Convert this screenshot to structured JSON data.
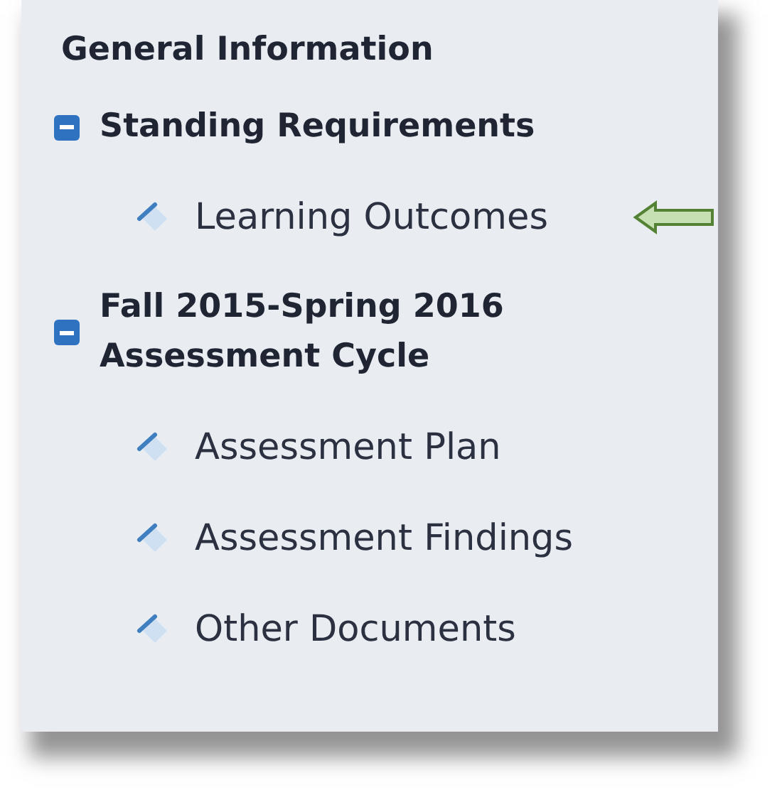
{
  "heading": "General Information",
  "groups": [
    {
      "title": "Standing Requirements",
      "expanded": true,
      "children": [
        {
          "label": "Learning Outcomes",
          "pointed": true
        }
      ]
    },
    {
      "title": "Fall 2015-Spring 2016 Assessment Cycle",
      "expanded": true,
      "children": [
        {
          "label": "Assessment Plan",
          "pointed": false
        },
        {
          "label": "Assessment Findings",
          "pointed": false
        },
        {
          "label": "Other Documents",
          "pointed": false
        }
      ]
    }
  ]
}
